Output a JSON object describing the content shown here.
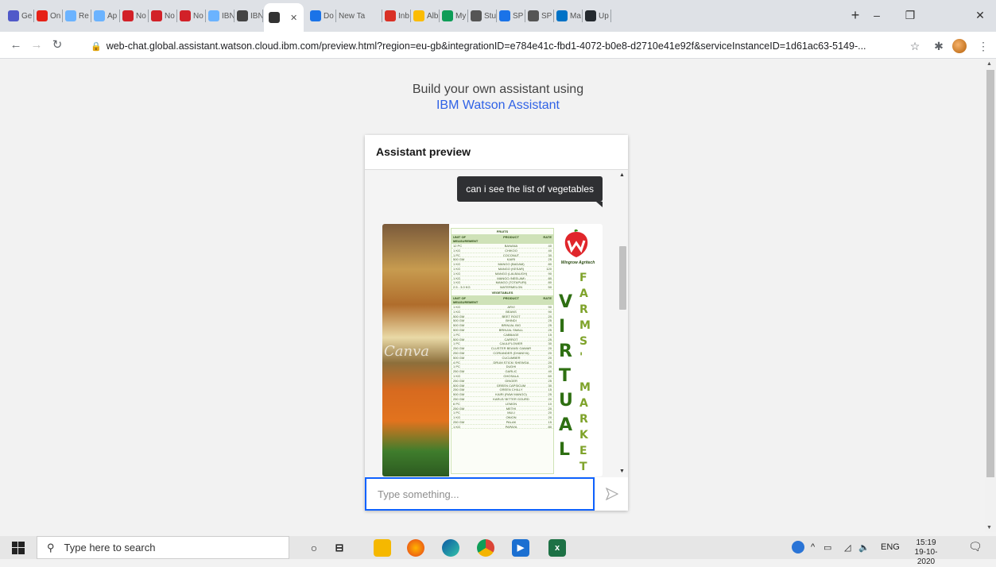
{
  "browser": {
    "tabs": [
      {
        "label": "Ge",
        "icon": "teams-icon",
        "color": "#5059c9"
      },
      {
        "label": "On",
        "icon": "youtube-icon",
        "color": "#e62117"
      },
      {
        "label": "Re",
        "icon": "cloud-icon",
        "color": "#6bb3ff"
      },
      {
        "label": "Ap",
        "icon": "cloud-icon",
        "color": "#6bb3ff"
      },
      {
        "label": "No",
        "icon": "notebook-icon",
        "color": "#d22128"
      },
      {
        "label": "No",
        "icon": "notebook-icon",
        "color": "#d22128"
      },
      {
        "label": "No",
        "icon": "notebook-icon",
        "color": "#d22128"
      },
      {
        "label": "IBN",
        "icon": "cloud-icon",
        "color": "#6bb3ff"
      },
      {
        "label": "IBN",
        "icon": "watson-icon",
        "color": "#444"
      },
      {
        "label": "Do",
        "icon": "download-icon",
        "color": "#1a73e8"
      },
      {
        "label": "New Ta",
        "icon": "",
        "color": ""
      },
      {
        "label": "Inb",
        "icon": "gmail-icon",
        "color": "#d93025"
      },
      {
        "label": "Alb",
        "icon": "photos-icon",
        "color": "#fbbc04"
      },
      {
        "label": "My",
        "icon": "drive-icon",
        "color": "#0f9d58"
      },
      {
        "label": "Stu",
        "icon": "chrome-icon",
        "color": "#555"
      },
      {
        "label": "SP",
        "icon": "doc-icon",
        "color": "#1a73e8"
      },
      {
        "label": "SP",
        "icon": "chrome-icon",
        "color": "#555"
      },
      {
        "label": "Ma",
        "icon": "outlook-icon",
        "color": "#0072c6"
      },
      {
        "label": "Up",
        "icon": "github-icon",
        "color": "#24292e"
      }
    ],
    "active_tab_icon": "watson-icon",
    "new_tab": "+",
    "window_controls": {
      "minimize": "–",
      "restore": "❐",
      "close": "✕"
    },
    "url": "web-chat.global.assistant.watson.cloud.ibm.com/preview.html?region=eu-gb&integrationID=e784e41c-fbd1-4072-b0e8-d2710e41e92f&serviceInstanceID=1d61ac63-5149-..."
  },
  "page": {
    "promo_line1": "Build your own assistant using",
    "promo_link": "IBM Watson Assistant",
    "chat": {
      "header": "Assistant preview",
      "user_message": "can i see the list of vegetables",
      "input_placeholder": "Type something...",
      "card": {
        "watermark": "Canva",
        "brand": "Wingrow Agritech",
        "vertical_word_1": "VIRTUAL",
        "vertical_word_2": "FARMS' MARKET",
        "fruits_title": "FRUITS",
        "vegetables_title": "VEGETABLES",
        "col_unit": "UNIT OF MEASUREMENT",
        "col_product": "PRODUCT",
        "col_rate": "RATE",
        "fruits": [
          [
            "12 PC",
            "BANANA",
            "40"
          ],
          [
            "1 KG",
            "CHIKOO",
            "40"
          ],
          [
            "1 PC",
            "COCONUT",
            "30"
          ],
          [
            "500 GM",
            "KAIRI",
            "25"
          ],
          [
            "1 KG",
            "MANGO (BADAM)",
            "80"
          ],
          [
            "1 KG",
            "MANGO (KESAR)",
            "120"
          ],
          [
            "1 KG",
            "MANGO (LALBAUGH)",
            "90"
          ],
          [
            "1 KG",
            "MANGO (NEELAM)",
            "80"
          ],
          [
            "1 KG",
            "MANGO (TOTAPURI)",
            "80"
          ],
          [
            "2.5 - 3.0 KG",
            "WATERMELON",
            "50"
          ]
        ],
        "vegetables": [
          [
            "1 KG",
            "ARVI",
            "90"
          ],
          [
            "1 KG",
            "BEANS",
            "90"
          ],
          [
            "500 GM",
            "BEET ROOT",
            "20"
          ],
          [
            "500 GM",
            "BHINDI",
            "25"
          ],
          [
            "500 GM",
            "BRINJAL BIG",
            "25"
          ],
          [
            "500 GM",
            "BRINJAL SMALL",
            "25"
          ],
          [
            "1 PC",
            "CABBAGE",
            "15"
          ],
          [
            "500 GM",
            "CARROT",
            "25"
          ],
          [
            "1 PC",
            "CAULIFLOWER",
            "30"
          ],
          [
            "250 GM",
            "CLUSTER BEANS/ GAWAR",
            "20"
          ],
          [
            "250 GM",
            "CORIANDER (DHANIYA)",
            "20"
          ],
          [
            "500 GM",
            "CUCUMBER",
            "20"
          ],
          [
            "4 PC",
            "DRUM STICK/ SHEWGA",
            "20"
          ],
          [
            "1 PC",
            "DUDHI",
            "20"
          ],
          [
            "250 GM",
            "GARLIC",
            "40"
          ],
          [
            "1 KG",
            "GHOSALA",
            "60"
          ],
          [
            "250 GM",
            "GINGER",
            "25"
          ],
          [
            "500 GM",
            "GREEN CAPSICUM",
            "30"
          ],
          [
            "250 GM",
            "GREEN CHILLY",
            "15"
          ],
          [
            "500 GM",
            "KAIRI (RAW MANGO)",
            "25"
          ],
          [
            "250 GM",
            "KARLE/ BITTER GOURD",
            "20"
          ],
          [
            "6 PC",
            "LEMON",
            "10"
          ],
          [
            "250 GM",
            "METHI",
            "20"
          ],
          [
            "1 PC",
            "MULI",
            "20"
          ],
          [
            "1 KG",
            "ONION",
            "20"
          ],
          [
            "250 GM",
            "PALAK",
            "15"
          ],
          [
            "1 KG",
            "PAPAYA",
            "80"
          ]
        ]
      }
    }
  },
  "taskbar": {
    "search_placeholder": "Type here to search",
    "tray_lang": "ENG",
    "time": "15:19",
    "date": "19-10-2020"
  }
}
